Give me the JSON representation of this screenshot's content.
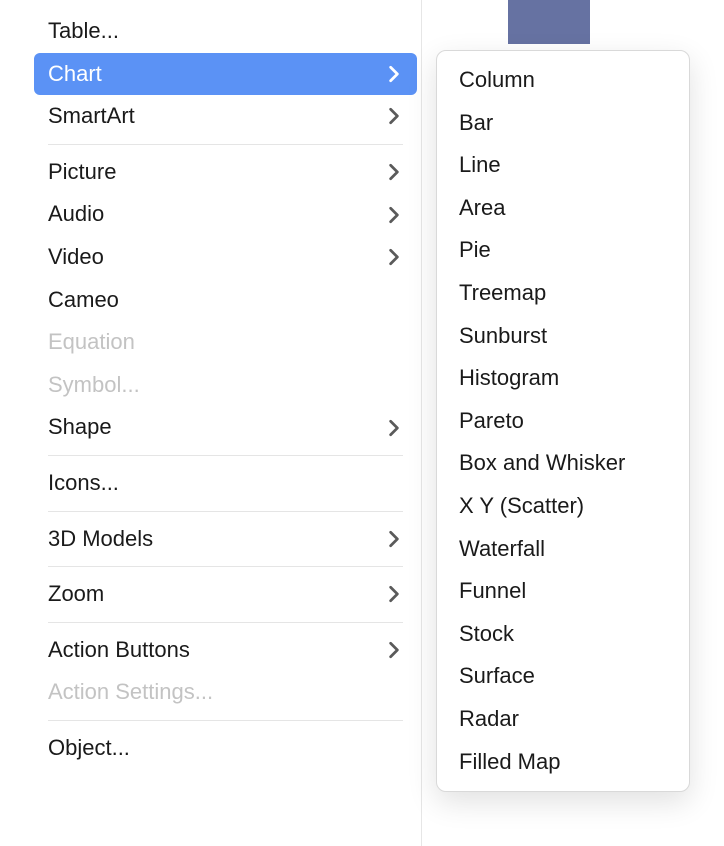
{
  "menu": {
    "items": [
      {
        "label": "Table...",
        "hasSubmenu": false,
        "disabled": false,
        "highlight": false
      },
      {
        "label": "Chart",
        "hasSubmenu": true,
        "disabled": false,
        "highlight": true
      },
      {
        "label": "SmartArt",
        "hasSubmenu": true,
        "disabled": false,
        "highlight": false
      },
      {
        "sep": true
      },
      {
        "label": "Picture",
        "hasSubmenu": true,
        "disabled": false,
        "highlight": false
      },
      {
        "label": "Audio",
        "hasSubmenu": true,
        "disabled": false,
        "highlight": false
      },
      {
        "label": "Video",
        "hasSubmenu": true,
        "disabled": false,
        "highlight": false
      },
      {
        "label": "Cameo",
        "hasSubmenu": false,
        "disabled": false,
        "highlight": false
      },
      {
        "label": "Equation",
        "hasSubmenu": false,
        "disabled": true,
        "highlight": false
      },
      {
        "label": "Symbol...",
        "hasSubmenu": false,
        "disabled": true,
        "highlight": false
      },
      {
        "label": "Shape",
        "hasSubmenu": true,
        "disabled": false,
        "highlight": false
      },
      {
        "sep": true
      },
      {
        "label": "Icons...",
        "hasSubmenu": false,
        "disabled": false,
        "highlight": false
      },
      {
        "sep": true
      },
      {
        "label": "3D Models",
        "hasSubmenu": true,
        "disabled": false,
        "highlight": false
      },
      {
        "sep": true
      },
      {
        "label": "Zoom",
        "hasSubmenu": true,
        "disabled": false,
        "highlight": false
      },
      {
        "sep": true
      },
      {
        "label": "Action Buttons",
        "hasSubmenu": true,
        "disabled": false,
        "highlight": false
      },
      {
        "label": "Action Settings...",
        "hasSubmenu": false,
        "disabled": true,
        "highlight": false
      },
      {
        "sep": true
      },
      {
        "label": "Object...",
        "hasSubmenu": false,
        "disabled": false,
        "highlight": false
      }
    ]
  },
  "submenu": {
    "items": [
      {
        "label": "Column"
      },
      {
        "label": "Bar"
      },
      {
        "label": "Line"
      },
      {
        "label": "Area"
      },
      {
        "label": "Pie"
      },
      {
        "label": "Treemap"
      },
      {
        "label": "Sunburst"
      },
      {
        "label": "Histogram"
      },
      {
        "label": "Pareto"
      },
      {
        "label": "Box and Whisker"
      },
      {
        "label": "X Y (Scatter)"
      },
      {
        "label": "Waterfall"
      },
      {
        "label": "Funnel"
      },
      {
        "label": "Stock"
      },
      {
        "label": "Surface"
      },
      {
        "label": "Radar"
      },
      {
        "label": "Filled Map"
      }
    ]
  }
}
